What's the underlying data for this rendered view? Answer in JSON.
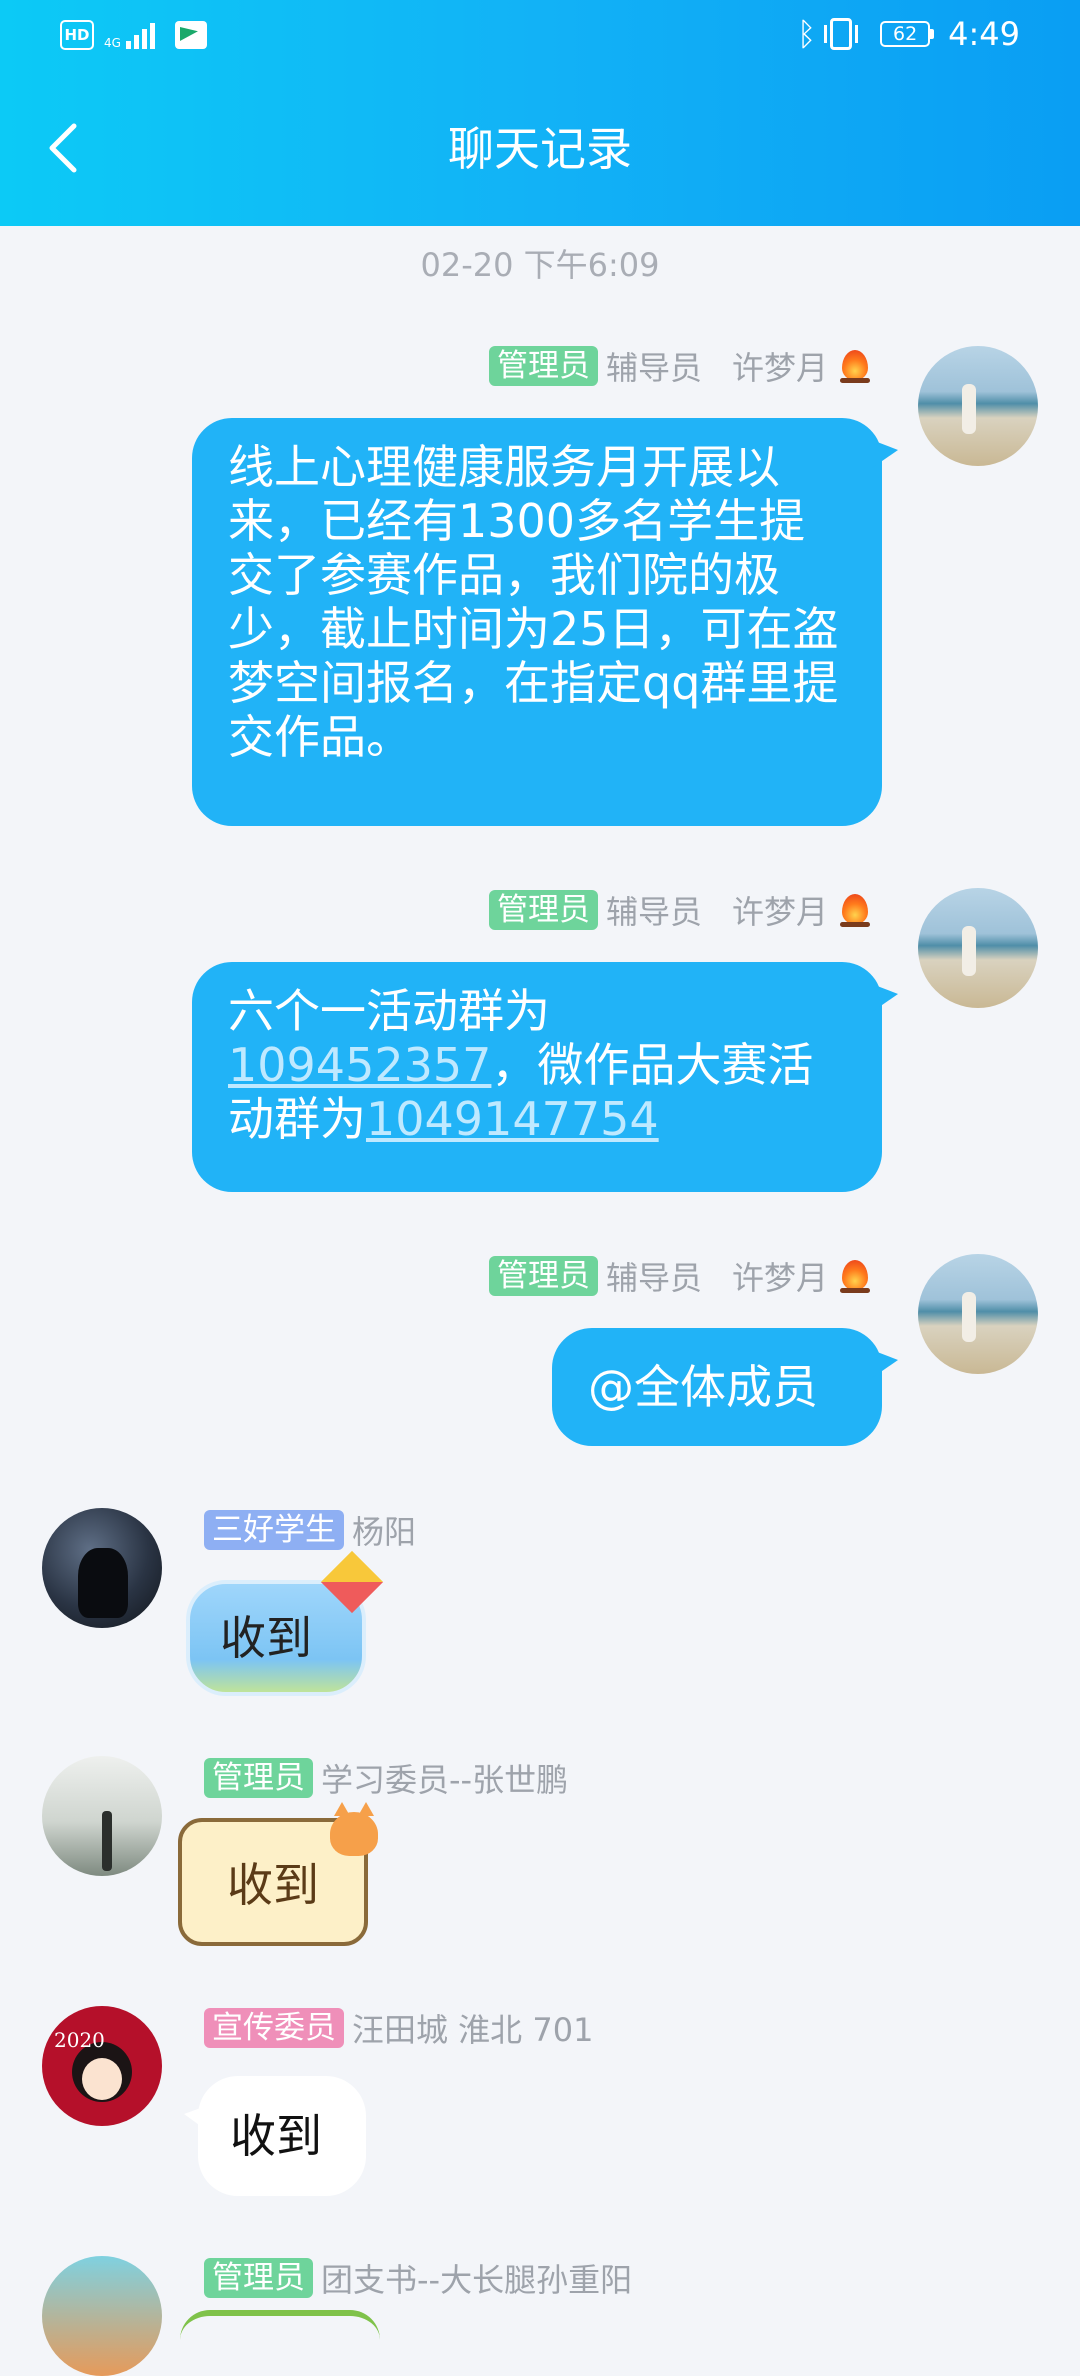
{
  "status_bar": {
    "hd": "HD",
    "network": "4G",
    "battery": "62",
    "time": "4:49"
  },
  "header": {
    "title": "聊天记录"
  },
  "timestamp": "02-20 下午6:09",
  "messages": [
    {
      "badge": "管理员",
      "role": "辅导员",
      "name": "许梦月",
      "text": "线上心理健康服务月开展以来，已经有1300多名学生提交了参赛作品，我们院的极少，截止时间为25日，可在盗梦空间报名，在指定qq群里提交作品。"
    },
    {
      "badge": "管理员",
      "role": "辅导员",
      "name": "许梦月",
      "text_prefix": "六个一活动群为",
      "link1": "109452357",
      "text_mid": "，微作品大赛活动群为",
      "link2": "1049147754"
    },
    {
      "badge": "管理员",
      "role": "辅导员",
      "name": "许梦月",
      "text": "@全体成员"
    },
    {
      "badge": "三好学生",
      "name": "杨阳",
      "text": "收到"
    },
    {
      "badge": "管理员",
      "name": "学习委员--张世鹏",
      "text": "收到"
    },
    {
      "badge": "宣传委员",
      "name": "汪田城  淮北  701",
      "avatar_text": "2020",
      "text": "收到"
    },
    {
      "badge": "管理员",
      "name": "团支书--大长腿孙重阳"
    }
  ]
}
